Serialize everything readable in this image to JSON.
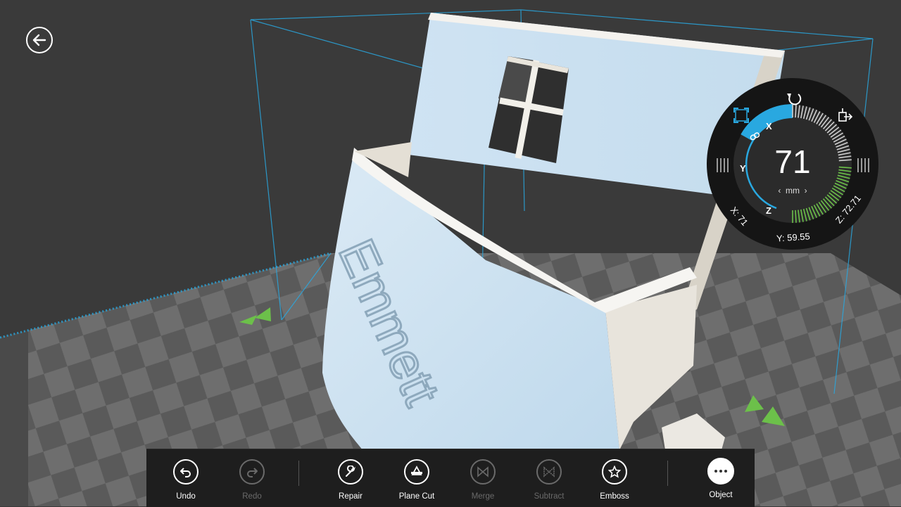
{
  "model": {
    "embossed_text": "Emmett"
  },
  "dial": {
    "value": "71",
    "unit": "mm",
    "unit_prev": "‹",
    "unit_next": "›",
    "axes": {
      "x": "X",
      "y": "Y",
      "z": "Z"
    },
    "readouts": {
      "x": "X: 71",
      "y": "Y: 59.55",
      "z": "Z: 72.71"
    },
    "accent_color": "#29a8e0",
    "z_color": "#6cc04a"
  },
  "toolbar": {
    "undo": "Undo",
    "redo": "Redo",
    "repair": "Repair",
    "plane_cut": "Plane Cut",
    "merge": "Merge",
    "subtract": "Subtract",
    "emboss": "Emboss",
    "object": "Object"
  },
  "icons": {
    "back": "arrow-left-icon",
    "undo": "undo-icon",
    "redo": "redo-icon",
    "repair": "wrench-icon",
    "plane_cut": "plane-cut-icon",
    "merge": "merge-icon",
    "subtract": "subtract-icon",
    "emboss": "star-icon",
    "object": "more-icon",
    "rotate": "rotate-icon",
    "scale": "scale-icon",
    "move": "move-icon"
  }
}
